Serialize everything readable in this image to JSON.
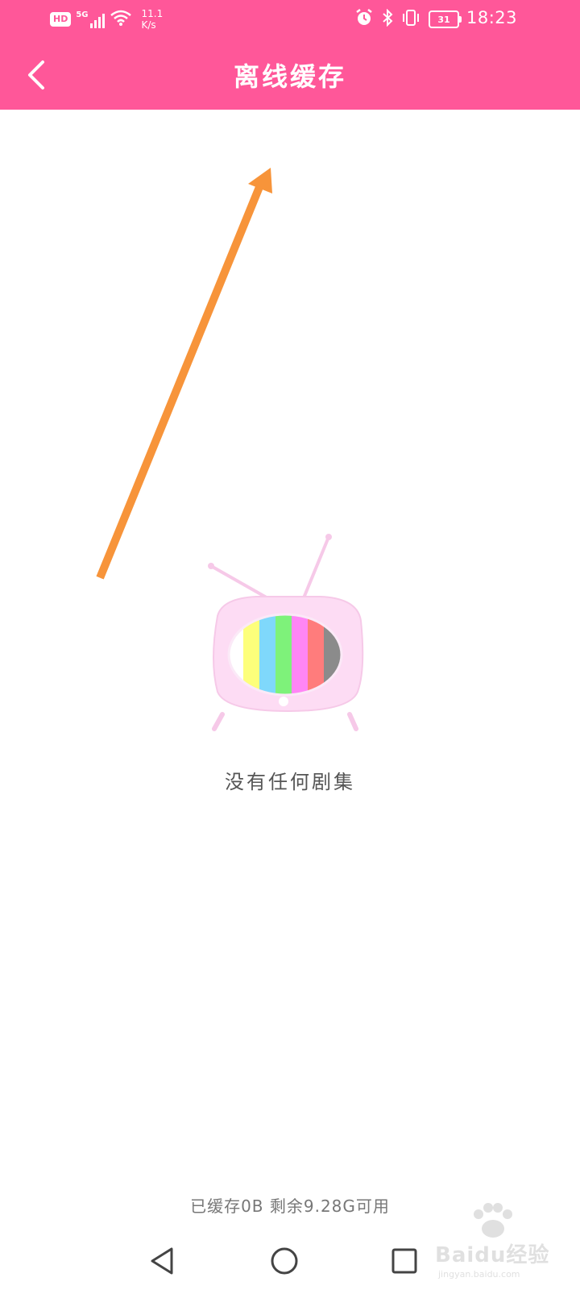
{
  "status_bar": {
    "hd_label": "HD",
    "network_label": "5G",
    "net_speed_value": "11.1",
    "net_speed_unit": "K/s",
    "battery_level": "31",
    "time": "18:23"
  },
  "app_bar": {
    "title": "离线缓存",
    "back_icon": "chevron-left-icon"
  },
  "empty_state": {
    "illustration": "tv-icon",
    "message": "没有任何剧集"
  },
  "storage": {
    "text": "已缓存0B 剩余9.28G可用"
  },
  "nav_bar": {
    "back_icon": "triangle-back-icon",
    "home_icon": "circle-home-icon",
    "recents_icon": "square-recents-icon"
  },
  "watermark": {
    "brand": "Baidu经验",
    "url": "jingyan.baidu.com"
  },
  "colors": {
    "primary": "#ff5799",
    "arrow": "#f7943a",
    "tv_body": "#fddcf4"
  }
}
